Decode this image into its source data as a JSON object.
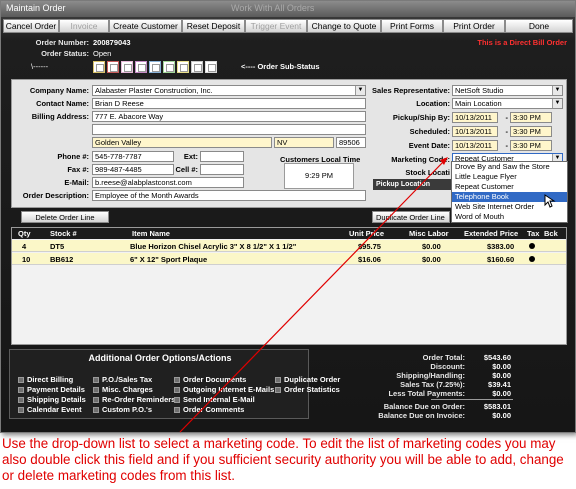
{
  "window": {
    "title": "Maintain Order",
    "ghost_title": "Work With All Orders"
  },
  "toolbar": [
    {
      "label": "Cancel Order",
      "enabled": true
    },
    {
      "label": "Invoice",
      "enabled": false
    },
    {
      "label": "Create Customer",
      "enabled": true
    },
    {
      "label": "Reset Deposit",
      "enabled": true
    },
    {
      "label": "Trigger Event",
      "enabled": false
    },
    {
      "label": "Change to Quote",
      "enabled": true
    },
    {
      "label": "Print Forms",
      "enabled": true
    },
    {
      "label": "Print Order",
      "enabled": true
    },
    {
      "label": "Done",
      "enabled": true
    }
  ],
  "header": {
    "order_number_label": "Order Number:",
    "order_number": "200879043",
    "order_status_label": "Order Status:",
    "order_status": "Open",
    "substatus_arrow": "\\------",
    "substatus_label": "<---- Order Sub-Status",
    "direct_bill": "This is a Direct Bill Order"
  },
  "customer": {
    "company_label": "Company Name:",
    "company": "Alabaster Plaster Construction, Inc.",
    "contact_label": "Contact Name:",
    "contact": "Brian D Reese",
    "billing_label": "Billing Address:",
    "address1": "777 E. Abacore Way",
    "address2": "",
    "city": "Golden Valley",
    "state": "NV",
    "zip": "89506",
    "phone_label": "Phone #:",
    "phone": "545-778-7787",
    "ext_label": "Ext:",
    "ext": "",
    "fax_label": "Fax #:",
    "fax": "989-487-4485",
    "cell_label": "Cell #:",
    "cell": "",
    "email_label": "E-Mail:",
    "email": "b.reese@alabplastconst.com",
    "description_label": "Order Description:",
    "description": "Employee of the Month Awards",
    "local_time_label": "Customers Local Time",
    "local_time": "9:29 PM"
  },
  "order_info": {
    "sales_rep_label": "Sales Representative:",
    "sales_rep": "NetSoft Studio",
    "location_label": "Location:",
    "location": "Main Location",
    "pickup_label": "Pickup/Ship By:",
    "pickup_date": "10/13/2011",
    "pickup_time": "3:30 PM",
    "scheduled_label": "Scheduled:",
    "scheduled_date": "10/13/2011",
    "scheduled_time": "3:30 PM",
    "event_label": "Event Date:",
    "event_date": "10/13/2011",
    "event_time": "3:30 PM",
    "marketing_label": "Marketing Code:",
    "marketing": "Repeat Customer",
    "stock_label": "Stock Locati",
    "pickup_location_label": "Pickup Location"
  },
  "marketing_options": [
    {
      "label": "Drove By and Saw the Store",
      "selected": false
    },
    {
      "label": "Little League Flyer",
      "selected": false
    },
    {
      "label": "Repeat Customer",
      "selected": false
    },
    {
      "label": "Telephone Book",
      "selected": true
    },
    {
      "label": "Web Site Internet Order",
      "selected": false
    },
    {
      "label": "Word of Mouth",
      "selected": false
    }
  ],
  "buttons": {
    "delete_line": "Delete Order Line",
    "duplicate_line": "Duplicate Order Line"
  },
  "grid": {
    "headers": [
      "Qty",
      "Stock #",
      "Item Name",
      "Unit Price",
      "Misc Labor",
      "Extended Price",
      "Tax",
      "Bck"
    ],
    "rows": [
      {
        "qty": "4",
        "stock": "DT5",
        "item": "Blue Horizon Chisel Acrylic 3\" X 8 1/2\" X 1 1/2\"",
        "unit": "$95.75",
        "misc": "$0.00",
        "ext": "$383.00",
        "tax": true
      },
      {
        "qty": "10",
        "stock": "BB612",
        "item": "6\" X 12\" Sport Plaque",
        "unit": "$16.06",
        "misc": "$0.00",
        "ext": "$160.60",
        "tax": true
      }
    ]
  },
  "additional_options": {
    "title": "Additional Order Options/Actions",
    "col1": [
      "Direct Billing",
      "Payment Details",
      "Shipping Details",
      "Calendar Event"
    ],
    "col2": [
      "P.O./Sales Tax",
      "Misc. Charges",
      "Re-Order Reminders",
      "Custom P.O.'s"
    ],
    "col3": [
      "Order Documents",
      "Outgoing Internet E-Mails",
      "Send Internal E-Mail",
      "Order Comments"
    ],
    "col4": [
      "Duplicate Order",
      "Order Statistics"
    ]
  },
  "totals": [
    {
      "label": "Order Total:",
      "value": "$543.60"
    },
    {
      "label": "Discount:",
      "value": "$0.00"
    },
    {
      "label": "Shipping/Handling:",
      "value": "$0.00"
    },
    {
      "label": "Sales Tax (7.25%):",
      "value": "$39.41"
    },
    {
      "label": "Less Total Payments:",
      "value": "$0.00"
    },
    {
      "label": "Balance Due on Order:",
      "value": "$583.01"
    },
    {
      "label": "Balance Due on Invoice:",
      "value": "$0.00"
    }
  ],
  "caption": "Use the drop-down list to select a marketing code.  To edit the list of marketing codes you may also double click this field and if you sufficient security authority you will be able to add, change or delete marketing codes from this list.",
  "colors": {
    "caption": "#e00000",
    "selection": "#316ac5",
    "row_highlight": "#fbf7c8",
    "date_field": "#fff6cc"
  }
}
